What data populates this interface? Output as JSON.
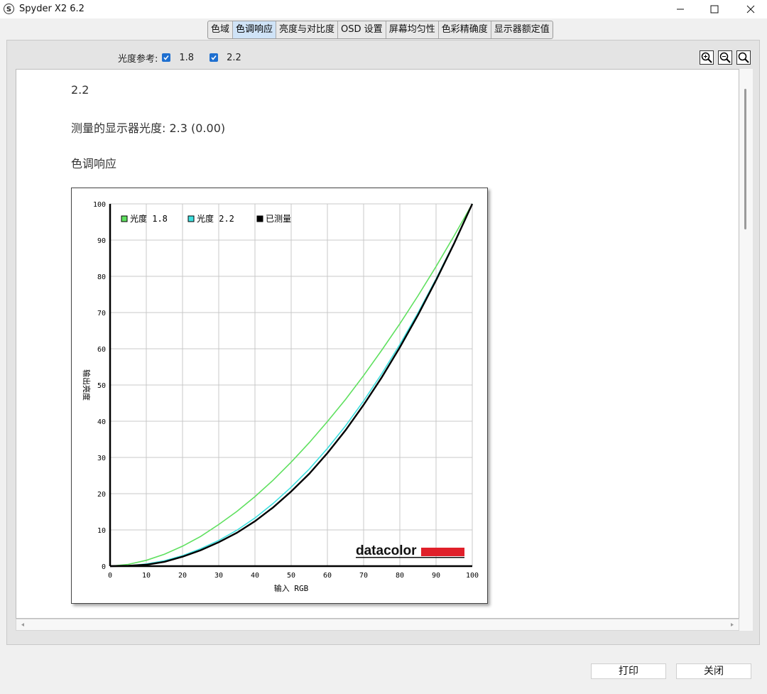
{
  "window": {
    "title": "Spyder X2 6.2",
    "logo_letter": "S"
  },
  "tabs": [
    {
      "label": "色域",
      "active": false
    },
    {
      "label": "色调响应",
      "active": true
    },
    {
      "label": "亮度与对比度",
      "active": false
    },
    {
      "label": "OSD 设置",
      "active": false
    },
    {
      "label": "屏幕均匀性",
      "active": false
    },
    {
      "label": "色彩精确度",
      "active": false
    },
    {
      "label": "显示器额定值",
      "active": false
    }
  ],
  "reference": {
    "label": "光度参考:",
    "options": [
      {
        "value": "1.8",
        "checked": true
      },
      {
        "value": "2.2",
        "checked": true
      }
    ]
  },
  "zoom": {
    "icons": [
      "zoom-in-icon",
      "zoom-out-icon",
      "zoom-reset-icon"
    ]
  },
  "report": {
    "gamma_heading": "2.2",
    "measured_text": "测量的显示器光度: 2.3 (0.00)",
    "section_title": "色调响应"
  },
  "chart_data": {
    "type": "line",
    "xlabel": "输入 RGB",
    "ylabel": "输出亮度",
    "xlim": [
      0,
      100
    ],
    "ylim": [
      0,
      100
    ],
    "xticks": [
      0,
      10,
      20,
      30,
      40,
      50,
      60,
      70,
      80,
      90,
      100
    ],
    "yticks": [
      0,
      10,
      20,
      30,
      40,
      50,
      60,
      70,
      80,
      90,
      100
    ],
    "grid": true,
    "legend_position": "top-left",
    "watermark": "datacolor",
    "series": [
      {
        "name": "光度 1.8",
        "color": "#5fe05f",
        "x": [
          0,
          5,
          10,
          15,
          20,
          25,
          30,
          35,
          40,
          45,
          50,
          55,
          60,
          65,
          70,
          75,
          80,
          85,
          90,
          95,
          100
        ],
        "y": [
          0,
          0.5,
          1.6,
          3.3,
          5.5,
          8.2,
          11.5,
          15.1,
          19.2,
          23.7,
          28.7,
          34.1,
          39.9,
          46.0,
          52.6,
          59.6,
          66.9,
          74.6,
          82.7,
          91.2,
          100
        ]
      },
      {
        "name": "光度 2.2",
        "color": "#3fe0e0",
        "x": [
          0,
          5,
          10,
          15,
          20,
          25,
          30,
          35,
          40,
          45,
          50,
          55,
          60,
          65,
          70,
          75,
          80,
          85,
          90,
          95,
          100
        ],
        "y": [
          0,
          0.1,
          0.6,
          1.5,
          2.9,
          4.8,
          7.1,
          9.9,
          13.3,
          17.3,
          21.8,
          26.8,
          32.5,
          38.7,
          45.6,
          53.1,
          61.2,
          69.9,
          79.3,
          89.3,
          100
        ]
      },
      {
        "name": "已测量",
        "color": "#000000",
        "x": [
          0,
          5,
          10,
          15,
          20,
          25,
          30,
          35,
          40,
          45,
          50,
          55,
          60,
          65,
          70,
          75,
          80,
          85,
          90,
          95,
          100
        ],
        "y": [
          0,
          0.1,
          0.4,
          1.2,
          2.6,
          4.4,
          6.6,
          9.2,
          12.4,
          16.2,
          20.6,
          25.5,
          31.2,
          37.5,
          44.5,
          52.1,
          60.4,
          69.3,
          78.9,
          89.1,
          100
        ]
      }
    ]
  },
  "buttons": {
    "print": "打印",
    "close": "关闭"
  },
  "colors": {
    "accent_checkbox": "#1e6fd0",
    "active_tab": "#cfe3f7",
    "datacolor_red": "#e0202a"
  }
}
